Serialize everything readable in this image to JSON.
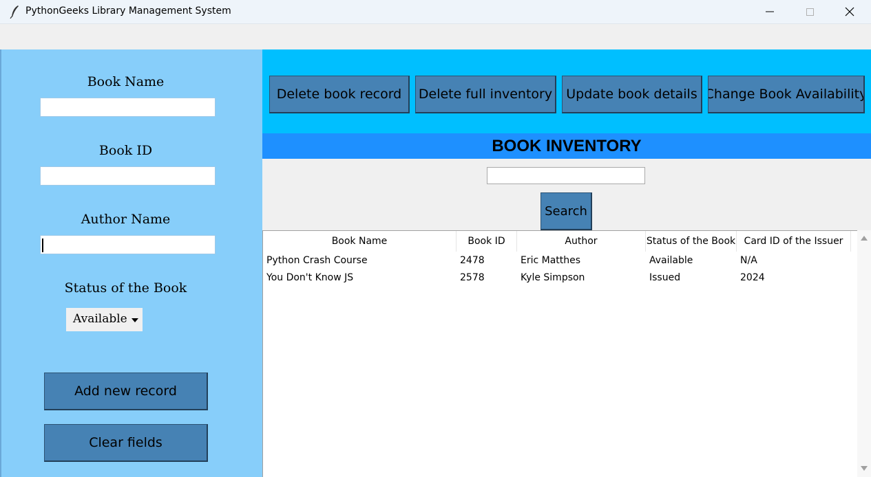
{
  "window": {
    "title": "PythonGeeks Library Management System",
    "icon": "feather-icon"
  },
  "form": {
    "book_name_label": "Book Name",
    "book_name_value": "",
    "book_id_label": "Book ID",
    "book_id_value": "",
    "author_label": "Author Name",
    "author_value": "",
    "status_label": "Status of the Book",
    "status_selected": "Available",
    "add_button": "Add new record",
    "clear_button": "Clear fields"
  },
  "toolbar": {
    "delete_record": "Delete book record",
    "delete_inventory": "Delete full inventory",
    "update_details": "Update book details",
    "change_availability": "Change Book Availability"
  },
  "inventory": {
    "header": "BOOK INVENTORY",
    "search_value": "",
    "search_button": "Search",
    "columns": [
      "Book Name",
      "Book ID",
      "Author",
      "Status of the Book",
      "Card ID of the Issuer"
    ],
    "rows": [
      [
        "Python Crash Course",
        "2478",
        "Eric Matthes",
        "Available",
        "N/A"
      ],
      [
        "You Don't Know JS",
        "2578",
        "Kyle Simpson",
        "Issued",
        "2024"
      ]
    ]
  },
  "colors": {
    "left_panel": "#87cefa",
    "top_panel": "#00bfff",
    "header_bar": "#1e90ff",
    "button": "#4682b4"
  }
}
